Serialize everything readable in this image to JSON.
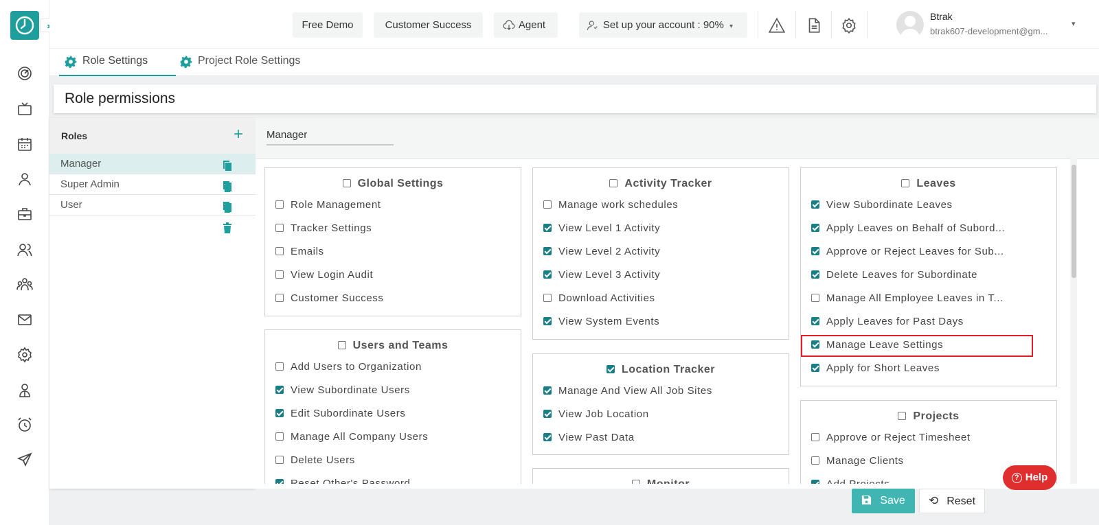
{
  "colors": {
    "accent": "#1e9e9c",
    "check": "#1a7e86",
    "highlight": "#e11d2a",
    "help": "#e02e2e"
  },
  "rail": {
    "icons": [
      "dashboard-icon",
      "tv-icon",
      "calendar-icon",
      "user-icon",
      "briefcase-icon",
      "users-icon",
      "team-icon",
      "mail-icon",
      "settings-icon",
      "employee-icon",
      "alarm-icon",
      "send-icon"
    ]
  },
  "topbar": {
    "free_demo": "Free Demo",
    "customer_success": "Customer Success",
    "agent": "Agent",
    "setup": "Set up your account : 90%",
    "user_name": "Btrak",
    "user_email": "btrak607-development@gm..."
  },
  "tabs": {
    "role_settings": "Role Settings",
    "project_role_settings": "Project Role Settings"
  },
  "page_title": "Role permissions",
  "roles": {
    "title": "Roles",
    "items": [
      {
        "label": "Manager"
      },
      {
        "label": "Super Admin"
      },
      {
        "label": "User"
      }
    ]
  },
  "selected_role": "Manager",
  "cards": {
    "global": {
      "title": "Global Settings",
      "checked": false,
      "items": [
        {
          "label": "Role Management",
          "checked": false
        },
        {
          "label": "Tracker Settings",
          "checked": false
        },
        {
          "label": "Emails",
          "checked": false
        },
        {
          "label": "View Login Audit",
          "checked": false
        },
        {
          "label": "Customer Success",
          "checked": false
        }
      ]
    },
    "users": {
      "title": "Users and Teams",
      "checked": false,
      "items": [
        {
          "label": "Add Users to Organization",
          "checked": false
        },
        {
          "label": "View Subordinate Users",
          "checked": true
        },
        {
          "label": "Edit Subordinate Users",
          "checked": true
        },
        {
          "label": "Manage All Company Users",
          "checked": false
        },
        {
          "label": "Delete Users",
          "checked": false
        },
        {
          "label": "Reset Other's Password",
          "checked": true
        }
      ]
    },
    "activity": {
      "title": "Activity Tracker",
      "checked": false,
      "items": [
        {
          "label": "Manage work schedules",
          "checked": false
        },
        {
          "label": "View Level 1 Activity",
          "checked": true
        },
        {
          "label": "View Level 2 Activity",
          "checked": true
        },
        {
          "label": "View Level 3 Activity",
          "checked": true
        },
        {
          "label": "Download Activities",
          "checked": false
        },
        {
          "label": "View System Events",
          "checked": true
        }
      ]
    },
    "location": {
      "title": "Location Tracker",
      "checked": true,
      "items": [
        {
          "label": "Manage And View All Job Sites",
          "checked": true
        },
        {
          "label": "View Job Location",
          "checked": true
        },
        {
          "label": "View Past Data",
          "checked": true
        }
      ]
    },
    "monitor": {
      "title": "Monitor",
      "checked": false
    },
    "leaves": {
      "title": "Leaves",
      "checked": false,
      "items": [
        {
          "label": "View Subordinate Leaves",
          "checked": true
        },
        {
          "label": "Apply Leaves on Behalf of Subord...",
          "checked": true
        },
        {
          "label": "Approve or Reject Leaves for Sub...",
          "checked": true
        },
        {
          "label": "Delete Leaves for Subordinate",
          "checked": true
        },
        {
          "label": "Manage All Employee Leaves in T...",
          "checked": false
        },
        {
          "label": "Apply Leaves for Past Days",
          "checked": true
        },
        {
          "label": "Manage Leave Settings",
          "checked": true
        },
        {
          "label": "Apply for Short Leaves",
          "checked": true
        }
      ]
    },
    "projects": {
      "title": "Projects",
      "checked": false,
      "items": [
        {
          "label": "Approve or Reject Timesheet",
          "checked": false
        },
        {
          "label": "Manage Clients",
          "checked": false
        },
        {
          "label": "Add Projects",
          "checked": true
        }
      ]
    }
  },
  "help_label": "Help",
  "save_label": "Save",
  "reset_label": "Reset"
}
